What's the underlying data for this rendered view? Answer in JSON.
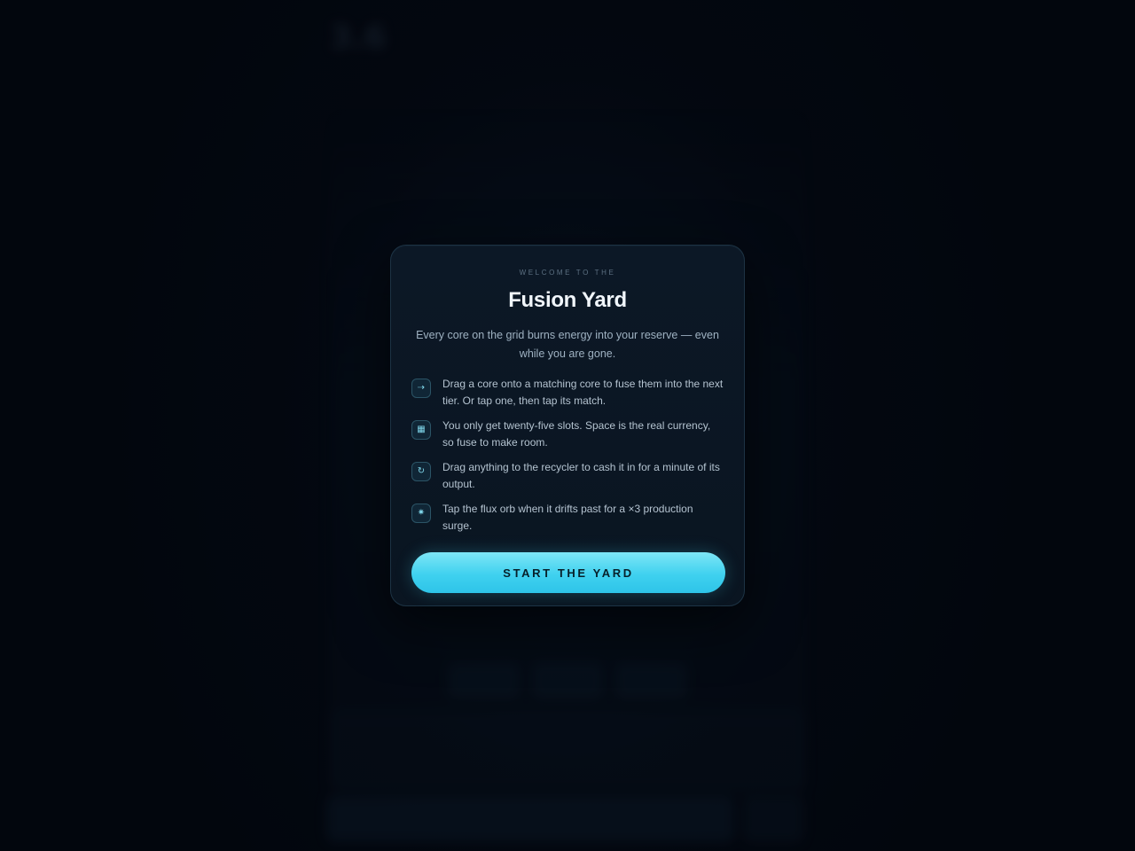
{
  "background": {
    "energy_value": "3.6"
  },
  "modal": {
    "eyebrow": "WELCOME TO THE",
    "title": "Fusion Yard",
    "subtitle": "Every core on the grid burns energy into your reserve — even while you are gone.",
    "tips": [
      {
        "icon": "arrow-right-icon",
        "glyph": "⇢",
        "text": "Drag a core onto a matching core to fuse them into the next tier. Or tap one, then tap its match."
      },
      {
        "icon": "grid-icon",
        "glyph": "▦",
        "text": "You only get twenty-five slots. Space is the real currency, so fuse to make room."
      },
      {
        "icon": "recycle-icon",
        "glyph": "↻",
        "text": "Drag anything to the recycler to cash it in for a minute of its output."
      },
      {
        "icon": "flux-orb-icon",
        "glyph": "✷",
        "text": "Tap the flux orb when it drifts past for a ×3 production surge."
      }
    ],
    "start_button": "START THE YARD"
  },
  "colors": {
    "accent": "#3fd1ef",
    "panel": "#0c1826",
    "background": "#03070f"
  }
}
